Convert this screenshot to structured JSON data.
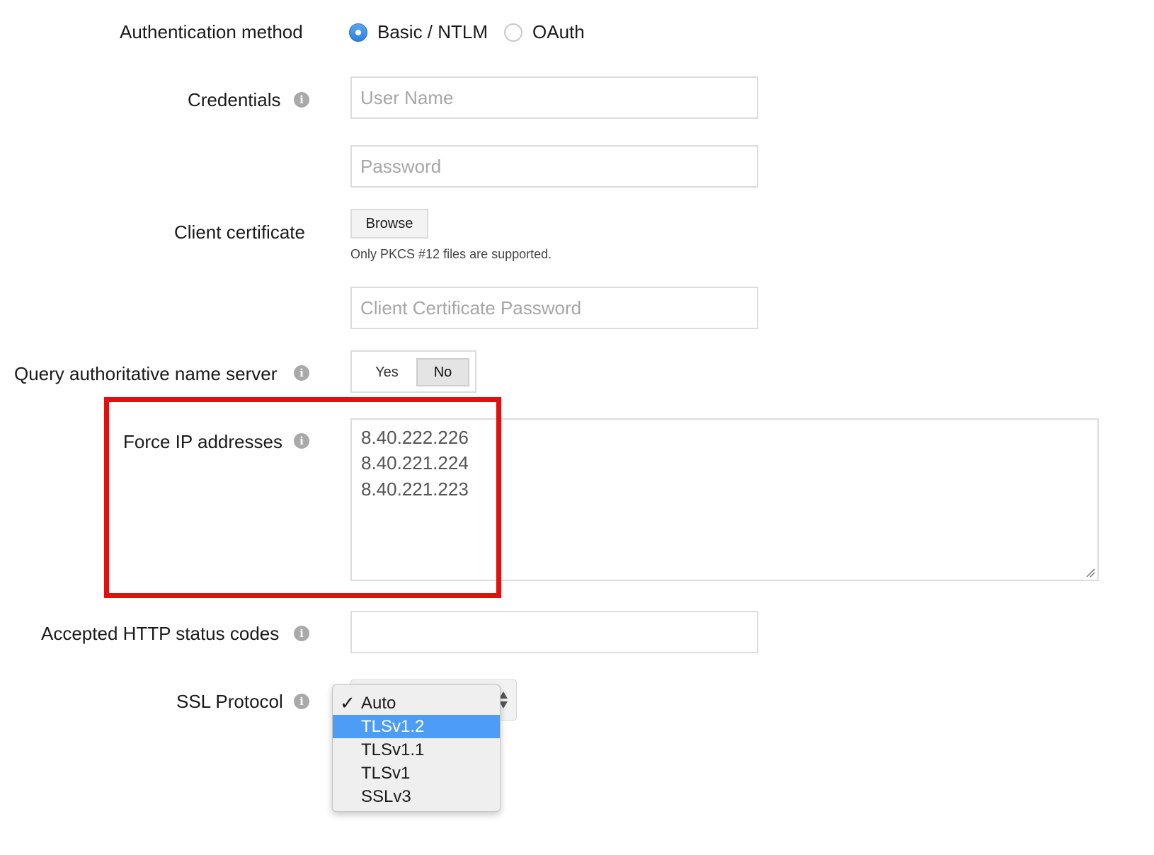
{
  "auth": {
    "label": "Authentication method",
    "options": [
      {
        "label": "Basic / NTLM",
        "checked": true
      },
      {
        "label": "OAuth",
        "checked": false
      }
    ]
  },
  "credentials": {
    "label": "Credentials",
    "username_placeholder": "User Name",
    "password_placeholder": "Password"
  },
  "client_cert": {
    "label": "Client certificate",
    "browse_label": "Browse",
    "hint": "Only PKCS #12 files are supported.",
    "password_placeholder": "Client Certificate Password"
  },
  "query_ns": {
    "label": "Query authoritative name server",
    "yes_label": "Yes",
    "no_label": "No",
    "selected": "No"
  },
  "force_ip": {
    "label": "Force IP addresses",
    "lines": [
      "8.40.222.226",
      "8.40.221.224",
      "8.40.221.223"
    ]
  },
  "http_codes": {
    "label": "Accepted HTTP status codes",
    "value": ""
  },
  "ssl": {
    "label": "SSL Protocol",
    "selected": "Auto",
    "hovered": "TLSv1.2",
    "options": [
      "Auto",
      "TLSv1.2",
      "TLSv1.1",
      "TLSv1",
      "SSLv3"
    ]
  },
  "info_icon_glyph": "i",
  "colors": {
    "accent": "#4d9cf6",
    "highlight": "#e01010"
  }
}
